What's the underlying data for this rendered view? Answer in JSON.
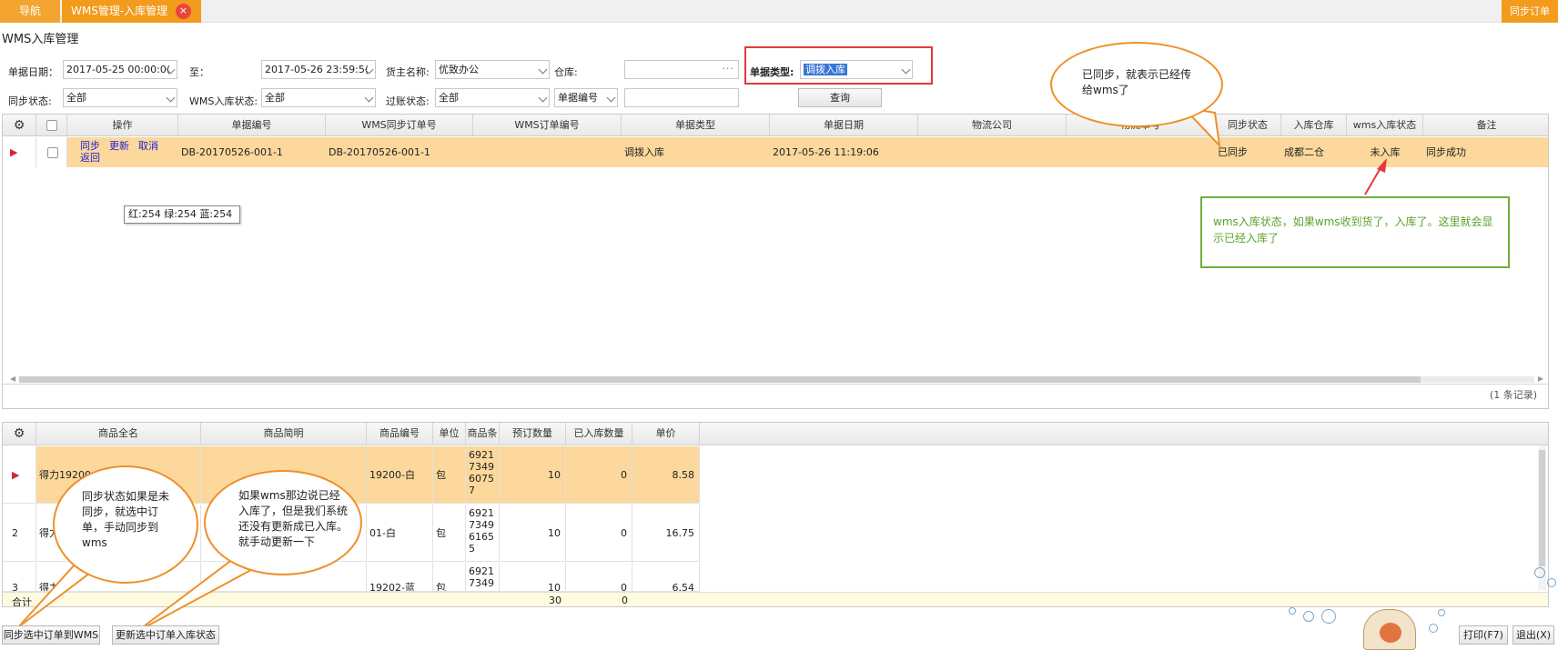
{
  "tabs": {
    "nav": "导航",
    "active": "WMS管理-入库管理",
    "close_icon": "×",
    "right": "同步订单"
  },
  "page_title": "WMS入库管理",
  "filters": {
    "date_label": "单据日期：",
    "date_from": "2017-05-25 00:00:0(",
    "to_label": "至：",
    "date_to": "2017-05-26 23:59:5(",
    "owner_label": "货主名称:",
    "owner_value": "优致办公",
    "warehouse_label": "仓库:",
    "warehouse_value": "",
    "doctype_label": "单据类型:",
    "doctype_value": "调拨入库",
    "sync_label": "同步状态:",
    "sync_value": "全部",
    "wms_state_label": "WMS入库状态:",
    "wms_state_value": "全部",
    "posting_label": "过账状态:",
    "posting_value": "全部",
    "docno_select": "单据编号",
    "docno_value": "",
    "query_button": "查询"
  },
  "grid": {
    "columns": [
      "",
      "",
      "操作",
      "单据编号",
      "WMS同步订单号",
      "WMS订单编号",
      "单据类型",
      "单据日期",
      "物流公司",
      "物流单号",
      "同步状态",
      "入库仓库",
      "wms入库状态",
      "备注"
    ],
    "rows": [
      {
        "ops": [
          "同步",
          "更新",
          "取消",
          "返回"
        ],
        "doc_no": "DB-20170526-001-1",
        "wms_sync_no": "DB-20170526-001-1",
        "wms_order_no": "",
        "doc_type": "调拨入库",
        "doc_date": "2017-05-26 11:19:06",
        "logistics": "",
        "logistics_no": "",
        "sync_state": "已同步",
        "warehouse": "成都二仓",
        "wms_state": "未入库",
        "remark": "同步成功"
      }
    ],
    "records": "(1 条记录)"
  },
  "tooltip": "红:254 绿:254 蓝:254",
  "detail": {
    "columns": [
      "",
      "商品全名",
      "商品简明",
      "商品编号",
      "单位",
      "商品条",
      "预订数量",
      "已入库数量",
      "单价"
    ],
    "rows": [
      {
        "idx": "▶",
        "name": "得力19200",
        "short": "",
        "code": "19200-白",
        "unit": "包",
        "barcode": [
          "6921",
          "7349",
          "6075",
          "7"
        ],
        "qty": "10",
        "in_qty": "0",
        "price": "8.58"
      },
      {
        "idx": "2",
        "name": "得力",
        "short": "",
        "code": "01-白",
        "unit": "包",
        "barcode": [
          "6921",
          "7349",
          "6165",
          "5"
        ],
        "qty": "10",
        "in_qty": "0",
        "price": "16.75"
      },
      {
        "idx": "3",
        "name": "得力",
        "short": "",
        "code": "19202-蓝",
        "unit": "包",
        "barcode": [
          "6921",
          "7349"
        ],
        "qty": "10",
        "in_qty": "0",
        "price": "6.54"
      }
    ],
    "total_label": "合计",
    "total_qty": "30",
    "total_in": "0"
  },
  "callouts": {
    "synced": "已同步，就表示已经传给wms了",
    "wms_state": "wms入库状态，如果wms收到货了，入库了。这里就会显示已经入库了",
    "manual_sync": "同步状态如果是未同步，就选中订单，手动同步到wms",
    "manual_update": "如果wms那边说已经入库了，但是我们系统还没有更新成已入库。就手动更新一下"
  },
  "bottom_buttons": {
    "sync_selected": "同步选中订单到WMS",
    "update_selected": "更新选中订单入库状态",
    "print": "打印(F7)",
    "exit": "退出(X)"
  }
}
